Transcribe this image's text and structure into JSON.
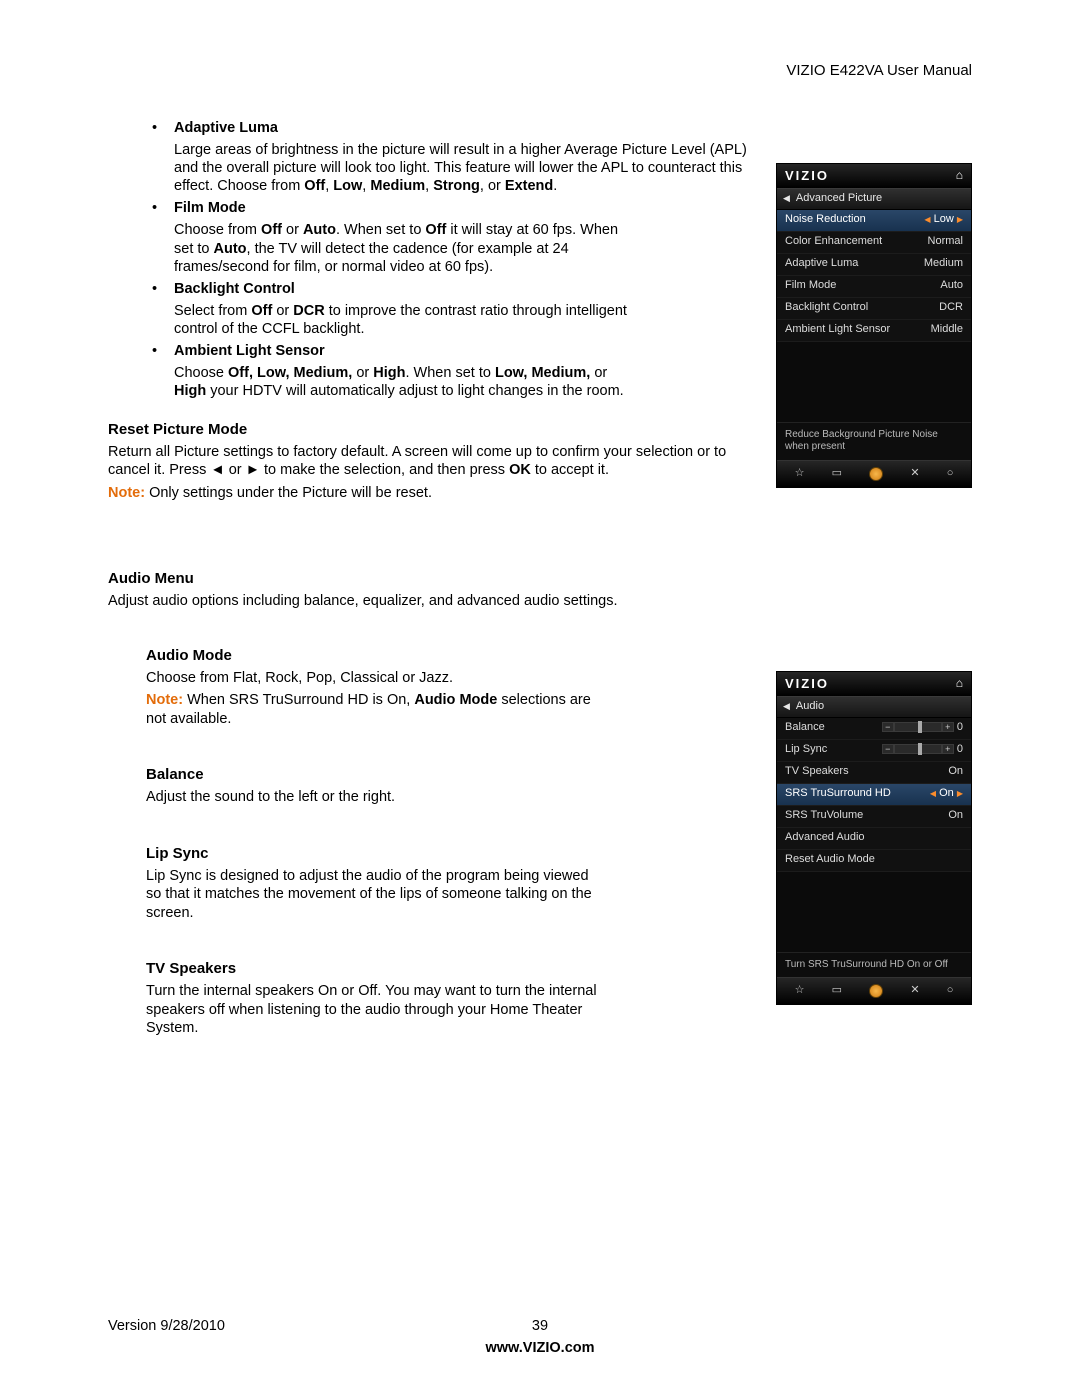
{
  "header": {
    "title": "VIZIO E422VA User Manual"
  },
  "picture_advanced_bullets": [
    {
      "title": "Adaptive Luma",
      "body_html": "Large areas of brightness in the picture will result in a higher Average Picture Level (APL) and the overall picture will look too light. This feature will lower the APL to counteract this effect. Choose from <b>Off</b>, <b>Low</b>, <b>Medium</b>, <b>Strong</b>, or <b>Extend</b>."
    },
    {
      "title": "Film Mode",
      "body_html": "Choose from <b>Off</b> or <b>Auto</b>. When set to <b>Off</b> it will stay at 60 fps. When set to <b>Auto</b>, the TV will detect the cadence (for example at 24 frames/second for film, or normal video at 60 fps)."
    },
    {
      "title": "Backlight Control",
      "body_html": "Select from <b>Off</b> or <b>DCR</b> to improve the contrast ratio through intelligent control of the CCFL backlight."
    },
    {
      "title": "Ambient Light Sensor",
      "body_html": "Choose <b>Off, Low, Medium,</b> or <b>High</b>. When set to <b>Low, Medium,</b> or <b>High</b> your HDTV will automatically adjust to light changes in the room."
    }
  ],
  "reset_picture": {
    "heading": "Reset Picture Mode",
    "body_html": "Return all Picture settings to factory default. A screen will come up to confirm your selection or to cancel it. Press ◄ or ► to make the selection, and then press <b>OK</b> to accept it.",
    "note_label": "Note:",
    "note_text": " Only settings under the Picture will be reset."
  },
  "audio_menu": {
    "heading": "Audio Menu",
    "intro": "Adjust audio options including balance, equalizer, and advanced audio settings.",
    "sections": [
      {
        "heading": "Audio Mode",
        "body_html": "Choose from Flat, Rock, Pop, Classical or Jazz.",
        "note_label": "Note:",
        "note_html": " When SRS TruSurround HD is On, <b>Audio Mode</b> selections are not available."
      },
      {
        "heading": "Balance",
        "body_html": "Adjust the sound to the left or the right."
      },
      {
        "heading": "Lip Sync",
        "body_html": "Lip Sync is designed to adjust the audio of the program being viewed so that it matches the movement of the lips of someone talking on the screen."
      },
      {
        "heading": "TV Speakers",
        "body_html": "Turn the internal speakers On or Off. You may want to turn the internal speakers off when listening to the audio through your Home Theater System."
      }
    ]
  },
  "osd_picture": {
    "logo": "VIZIO",
    "crumb": "Advanced Picture",
    "rows": [
      {
        "label": "Noise Reduction",
        "value": "Low",
        "selected": true,
        "arrows": true
      },
      {
        "label": "Color Enhancement",
        "value": "Normal"
      },
      {
        "label": "Adaptive Luma",
        "value": "Medium"
      },
      {
        "label": "Film Mode",
        "value": "Auto"
      },
      {
        "label": "Backlight Control",
        "value": "DCR"
      },
      {
        "label": "Ambient Light Sensor",
        "value": "Middle"
      }
    ],
    "hint": "Reduce Background Picture Noise when present"
  },
  "osd_audio": {
    "logo": "VIZIO",
    "crumb": "Audio",
    "rows": [
      {
        "label": "Balance",
        "type": "slider",
        "value": "0"
      },
      {
        "label": "Lip Sync",
        "type": "slider",
        "value": "0"
      },
      {
        "label": "TV Speakers",
        "value": "On"
      },
      {
        "label": "SRS TruSurround HD",
        "value": "On",
        "selected": true,
        "arrows": true
      },
      {
        "label": "SRS TruVolume",
        "value": "On"
      },
      {
        "label": "Advanced Audio",
        "value": ""
      },
      {
        "label": "Reset Audio Mode",
        "value": ""
      }
    ],
    "hint": "Turn SRS TruSurround HD On or Off"
  },
  "footer": {
    "version": "Version 9/28/2010",
    "page_number": "39",
    "url": "www.VIZIO.com"
  }
}
